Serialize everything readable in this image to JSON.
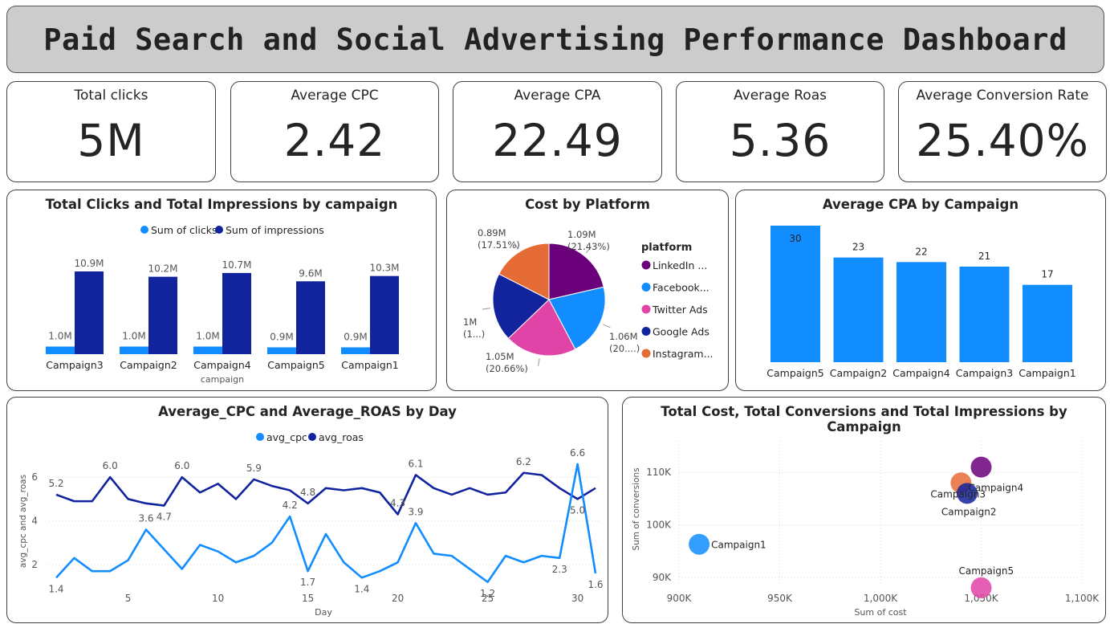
{
  "title": "Paid Search and Social Advertising Performance Dashboard",
  "kpis": [
    {
      "label": "Total clicks",
      "value": "5M"
    },
    {
      "label": "Average CPC",
      "value": "2.42"
    },
    {
      "label": "Average CPA",
      "value": "22.49"
    },
    {
      "label": "Average Roas",
      "value": "5.36"
    },
    {
      "label": "Average Conversion Rate",
      "value": "25.40%"
    }
  ],
  "colors": {
    "light_blue": "#118DFF",
    "dark_blue": "#12239E",
    "purple": "#6B007B",
    "pink": "#E044A7",
    "orange": "#E66C37"
  },
  "chart_data": [
    {
      "type": "bar",
      "title": "Total Clicks and Total Impressions by campaign",
      "xlabel": "campaign",
      "categories": [
        "Campaign3",
        "Campaign2",
        "Campaign4",
        "Campaign5",
        "Campaign1"
      ],
      "series": [
        {
          "name": "Sum of clicks",
          "values": [
            1.0,
            1.0,
            1.0,
            0.9,
            0.9
          ],
          "labels": [
            "1.0M",
            "1.0M",
            "1.0M",
            "0.9M",
            "0.9M"
          ],
          "color": "#118DFF"
        },
        {
          "name": "Sum of impressions",
          "values": [
            10.9,
            10.2,
            10.7,
            9.6,
            10.3
          ],
          "labels": [
            "10.9M",
            "10.2M",
            "10.7M",
            "9.6M",
            "10.3M"
          ],
          "color": "#12239E"
        }
      ],
      "legend": "top-center"
    },
    {
      "type": "pie",
      "title": "Cost by Platform",
      "legend_title": "platform",
      "slices": [
        {
          "name": "LinkedIn ...",
          "value": 1.09,
          "label": "1.09M",
          "pct": "(21.43%)",
          "color": "#6B007B"
        },
        {
          "name": "Facebook...",
          "value": 1.06,
          "label": "1.06M",
          "pct": "(20....)",
          "color": "#118DFF"
        },
        {
          "name": "Twitter Ads",
          "value": 1.05,
          "label": "1.05M",
          "pct": "(20.66%)",
          "color": "#E044A7"
        },
        {
          "name": "Google Ads",
          "value": 1.0,
          "label": "1M",
          "pct": "(1...)",
          "color": "#12239E"
        },
        {
          "name": "Instagram...",
          "value": 0.89,
          "label": "0.89M",
          "pct": "(17.51%)",
          "color": "#E66C37"
        }
      ],
      "legend": "right"
    },
    {
      "type": "bar",
      "title": "Average CPA by Campaign",
      "categories": [
        "Campaign5",
        "Campaign2",
        "Campaign4",
        "Campaign3",
        "Campaign1"
      ],
      "values": [
        30,
        23,
        22,
        21,
        17
      ],
      "labels": [
        "30",
        "23",
        "22",
        "21",
        "17"
      ],
      "color": "#118DFF"
    },
    {
      "type": "line",
      "title": "Average_CPC and Average_ROAS by Day",
      "xlabel": "Day",
      "ylabel": "avg_cpc and avg_roas",
      "x": [
        1,
        2,
        3,
        4,
        5,
        6,
        7,
        8,
        9,
        10,
        11,
        12,
        13,
        14,
        15,
        16,
        17,
        18,
        19,
        20,
        21,
        22,
        23,
        24,
        25,
        26,
        27,
        28,
        29,
        30,
        31
      ],
      "xticks": [
        5,
        10,
        15,
        20,
        25,
        30
      ],
      "yticks": [
        2,
        4,
        6
      ],
      "series": [
        {
          "name": "avg_cpc",
          "color": "#118DFF",
          "values": [
            1.4,
            2.3,
            1.7,
            1.7,
            2.2,
            3.6,
            2.7,
            1.8,
            2.9,
            2.6,
            2.1,
            2.4,
            3.0,
            4.2,
            1.7,
            3.4,
            2.1,
            1.4,
            1.7,
            2.1,
            3.9,
            2.5,
            2.4,
            1.8,
            1.2,
            2.4,
            2.1,
            2.4,
            2.3,
            6.6,
            1.6
          ],
          "point_labels": {
            "1": "1.4",
            "6": "3.6",
            "14": "4.2",
            "15": "1.7",
            "18": "1.4",
            "21": "3.9",
            "25": "1.2",
            "29": "2.3",
            "30": "6.6",
            "31": "1.6"
          }
        },
        {
          "name": "avg_roas",
          "color": "#12239E",
          "values": [
            5.2,
            4.9,
            4.9,
            6.0,
            5.0,
            4.8,
            4.7,
            6.0,
            5.3,
            5.7,
            5.0,
            5.9,
            5.6,
            5.4,
            4.8,
            5.5,
            5.4,
            5.5,
            5.3,
            4.3,
            6.1,
            5.5,
            5.2,
            5.5,
            5.2,
            5.3,
            6.2,
            6.1,
            5.5,
            5.0,
            5.5
          ],
          "point_labels": {
            "1": "5.2",
            "4": "6.0",
            "7": "4.7",
            "8": "6.0",
            "12": "5.9",
            "15": "4.8",
            "20": "4.3",
            "21": "6.1",
            "27": "6.2",
            "30": "5.0"
          }
        }
      ],
      "legend": "top-center"
    },
    {
      "type": "scatter",
      "title": "Total Cost, Total Conversions and Total Impressions by Campaign",
      "xlabel": "Sum of cost",
      "ylabel": "Sum of conversions",
      "xticks": [
        "900K",
        "950K",
        "1,000K",
        "1,050K",
        "1,100K"
      ],
      "yticks": [
        "90K",
        "100K",
        "110K"
      ],
      "xlim": [
        900000,
        1100000
      ],
      "ylim": [
        86000,
        116000
      ],
      "points": [
        {
          "name": "Campaign1",
          "x": 910000,
          "y": 96300,
          "color": "#118DFF"
        },
        {
          "name": "Campaign4",
          "x": 1050000,
          "y": 111000,
          "color": "#6B007B"
        },
        {
          "name": "Campaign3",
          "x": 1040000,
          "y": 108000,
          "color": "#E66C37"
        },
        {
          "name": "Campaign2",
          "x": 1043000,
          "y": 106000,
          "color": "#12239E"
        },
        {
          "name": "Campaign5",
          "x": 1050000,
          "y": 88000,
          "color": "#E044A7"
        }
      ]
    }
  ]
}
